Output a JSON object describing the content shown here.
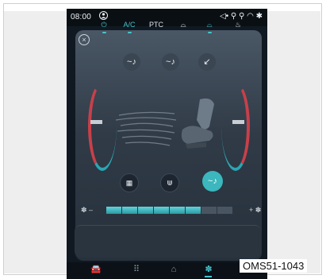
{
  "status_bar": {
    "time": "08:00",
    "person_icon": "person-icon",
    "icons": "◁• ⚲ ⚲ ◠ ✱"
  },
  "climate": {
    "close_symbol": "×",
    "top_vents": [
      {
        "name": "vent-face-icon",
        "glyph": "~♪"
      },
      {
        "name": "vent-face-feet-icon",
        "glyph": "~♪"
      },
      {
        "name": "vent-feet-icon",
        "glyph": "↙"
      }
    ],
    "mode_buttons": [
      {
        "name": "rear-defrost-icon",
        "glyph": "▦",
        "active": false
      },
      {
        "name": "front-defrost-icon",
        "glyph": "⋓",
        "active": false
      },
      {
        "name": "airflow-auto-icon",
        "glyph": "~♪",
        "active": true
      }
    ],
    "fan_speed": {
      "minus": "✽ –",
      "plus": "+ ✽",
      "level": 6,
      "max": 8
    },
    "bottom_bar": [
      {
        "name": "power-button",
        "label": "⏻",
        "on": true
      },
      {
        "name": "ac-button",
        "label": "A/C",
        "on": true
      },
      {
        "name": "ptc-button",
        "label": "PTC",
        "on": false
      },
      {
        "name": "recirculation-button",
        "label": "⌓",
        "on": false
      },
      {
        "name": "fresh-air-button",
        "label": "⌓",
        "on": true
      },
      {
        "name": "seat-heat-button",
        "label": "♨",
        "on": false
      }
    ],
    "colors": {
      "accent": "#46c5cc",
      "hot": "#c8404a",
      "cold": "#2aa7b3"
    }
  },
  "nav": [
    {
      "name": "car-icon",
      "glyph": "🚘",
      "on": false
    },
    {
      "name": "apps-grid-icon",
      "glyph": "⠿",
      "on": false
    },
    {
      "name": "home-icon",
      "glyph": "⌂",
      "on": false
    },
    {
      "name": "fan-icon",
      "glyph": "✽",
      "on": true
    }
  ],
  "caption": "OMS51-1043"
}
